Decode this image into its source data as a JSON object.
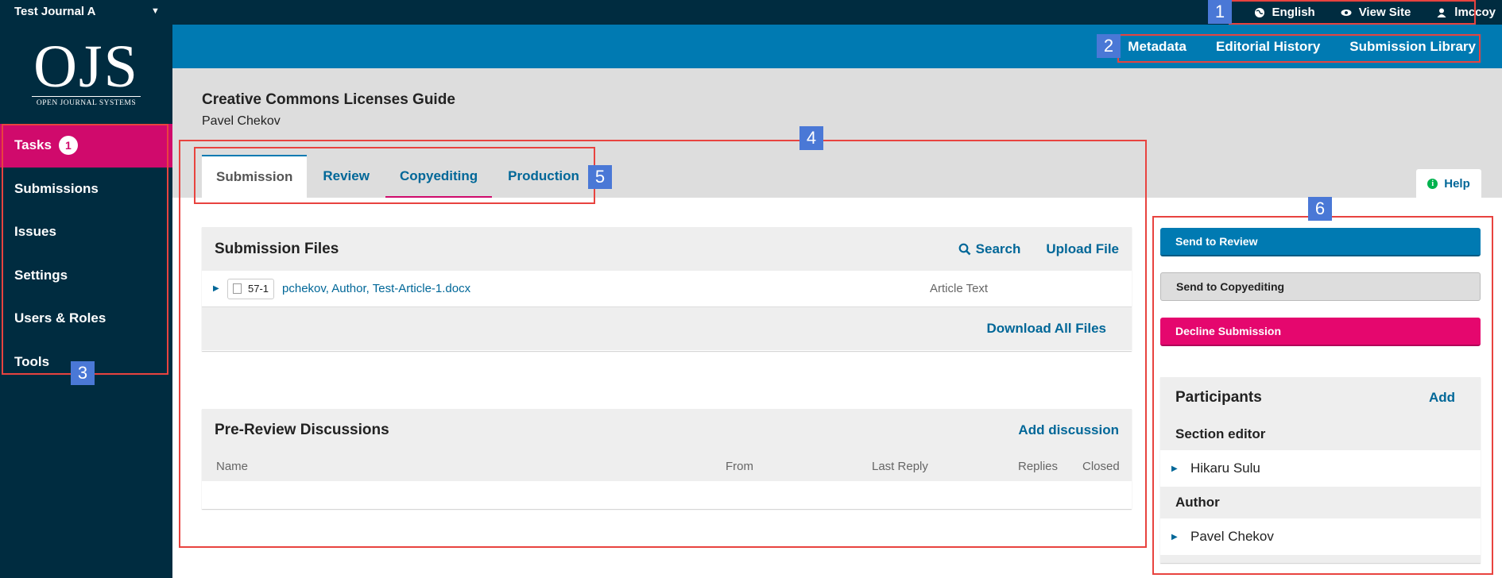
{
  "topbar": {
    "journal": "Test Journal A",
    "language": "English",
    "view_site": "View Site",
    "user": "lmccoy"
  },
  "logo": {
    "text": "OJS",
    "subtitle": "OPEN JOURNAL SYSTEMS"
  },
  "sidebar": {
    "items": [
      {
        "label": "Tasks",
        "badge": "1"
      },
      {
        "label": "Submissions"
      },
      {
        "label": "Issues"
      },
      {
        "label": "Settings"
      },
      {
        "label": "Users & Roles"
      },
      {
        "label": "Tools"
      }
    ]
  },
  "submission_nav": [
    "Metadata",
    "Editorial History",
    "Submission Library"
  ],
  "submission": {
    "title": "Creative Commons Licenses Guide",
    "author": "Pavel Chekov"
  },
  "tabs": [
    "Submission",
    "Review",
    "Copyediting",
    "Production"
  ],
  "help": "Help",
  "files": {
    "title": "Submission Files",
    "search": "Search",
    "upload": "Upload File",
    "rows": [
      {
        "id": "57-1",
        "name": "pchekov, Author, Test-Article-1.docx",
        "genre": "Article Text"
      }
    ],
    "download_all": "Download All Files"
  },
  "discussions": {
    "title": "Pre-Review Discussions",
    "add": "Add discussion",
    "columns": [
      "Name",
      "From",
      "Last Reply",
      "Replies",
      "Closed"
    ]
  },
  "actions": {
    "send_review": "Send to Review",
    "send_copyediting": "Send to Copyediting",
    "decline": "Decline Submission"
  },
  "participants": {
    "title": "Participants",
    "add": "Add",
    "groups": [
      {
        "role": "Section editor",
        "people": [
          "Hikaru Sulu"
        ]
      },
      {
        "role": "Author",
        "people": [
          "Pavel Chekov"
        ]
      }
    ]
  },
  "annotations": [
    "1",
    "2",
    "3",
    "4",
    "5",
    "6"
  ],
  "colors": {
    "dark": "#002c40",
    "blue": "#007ab2",
    "pink": "#d00a6c",
    "link": "#006798"
  }
}
